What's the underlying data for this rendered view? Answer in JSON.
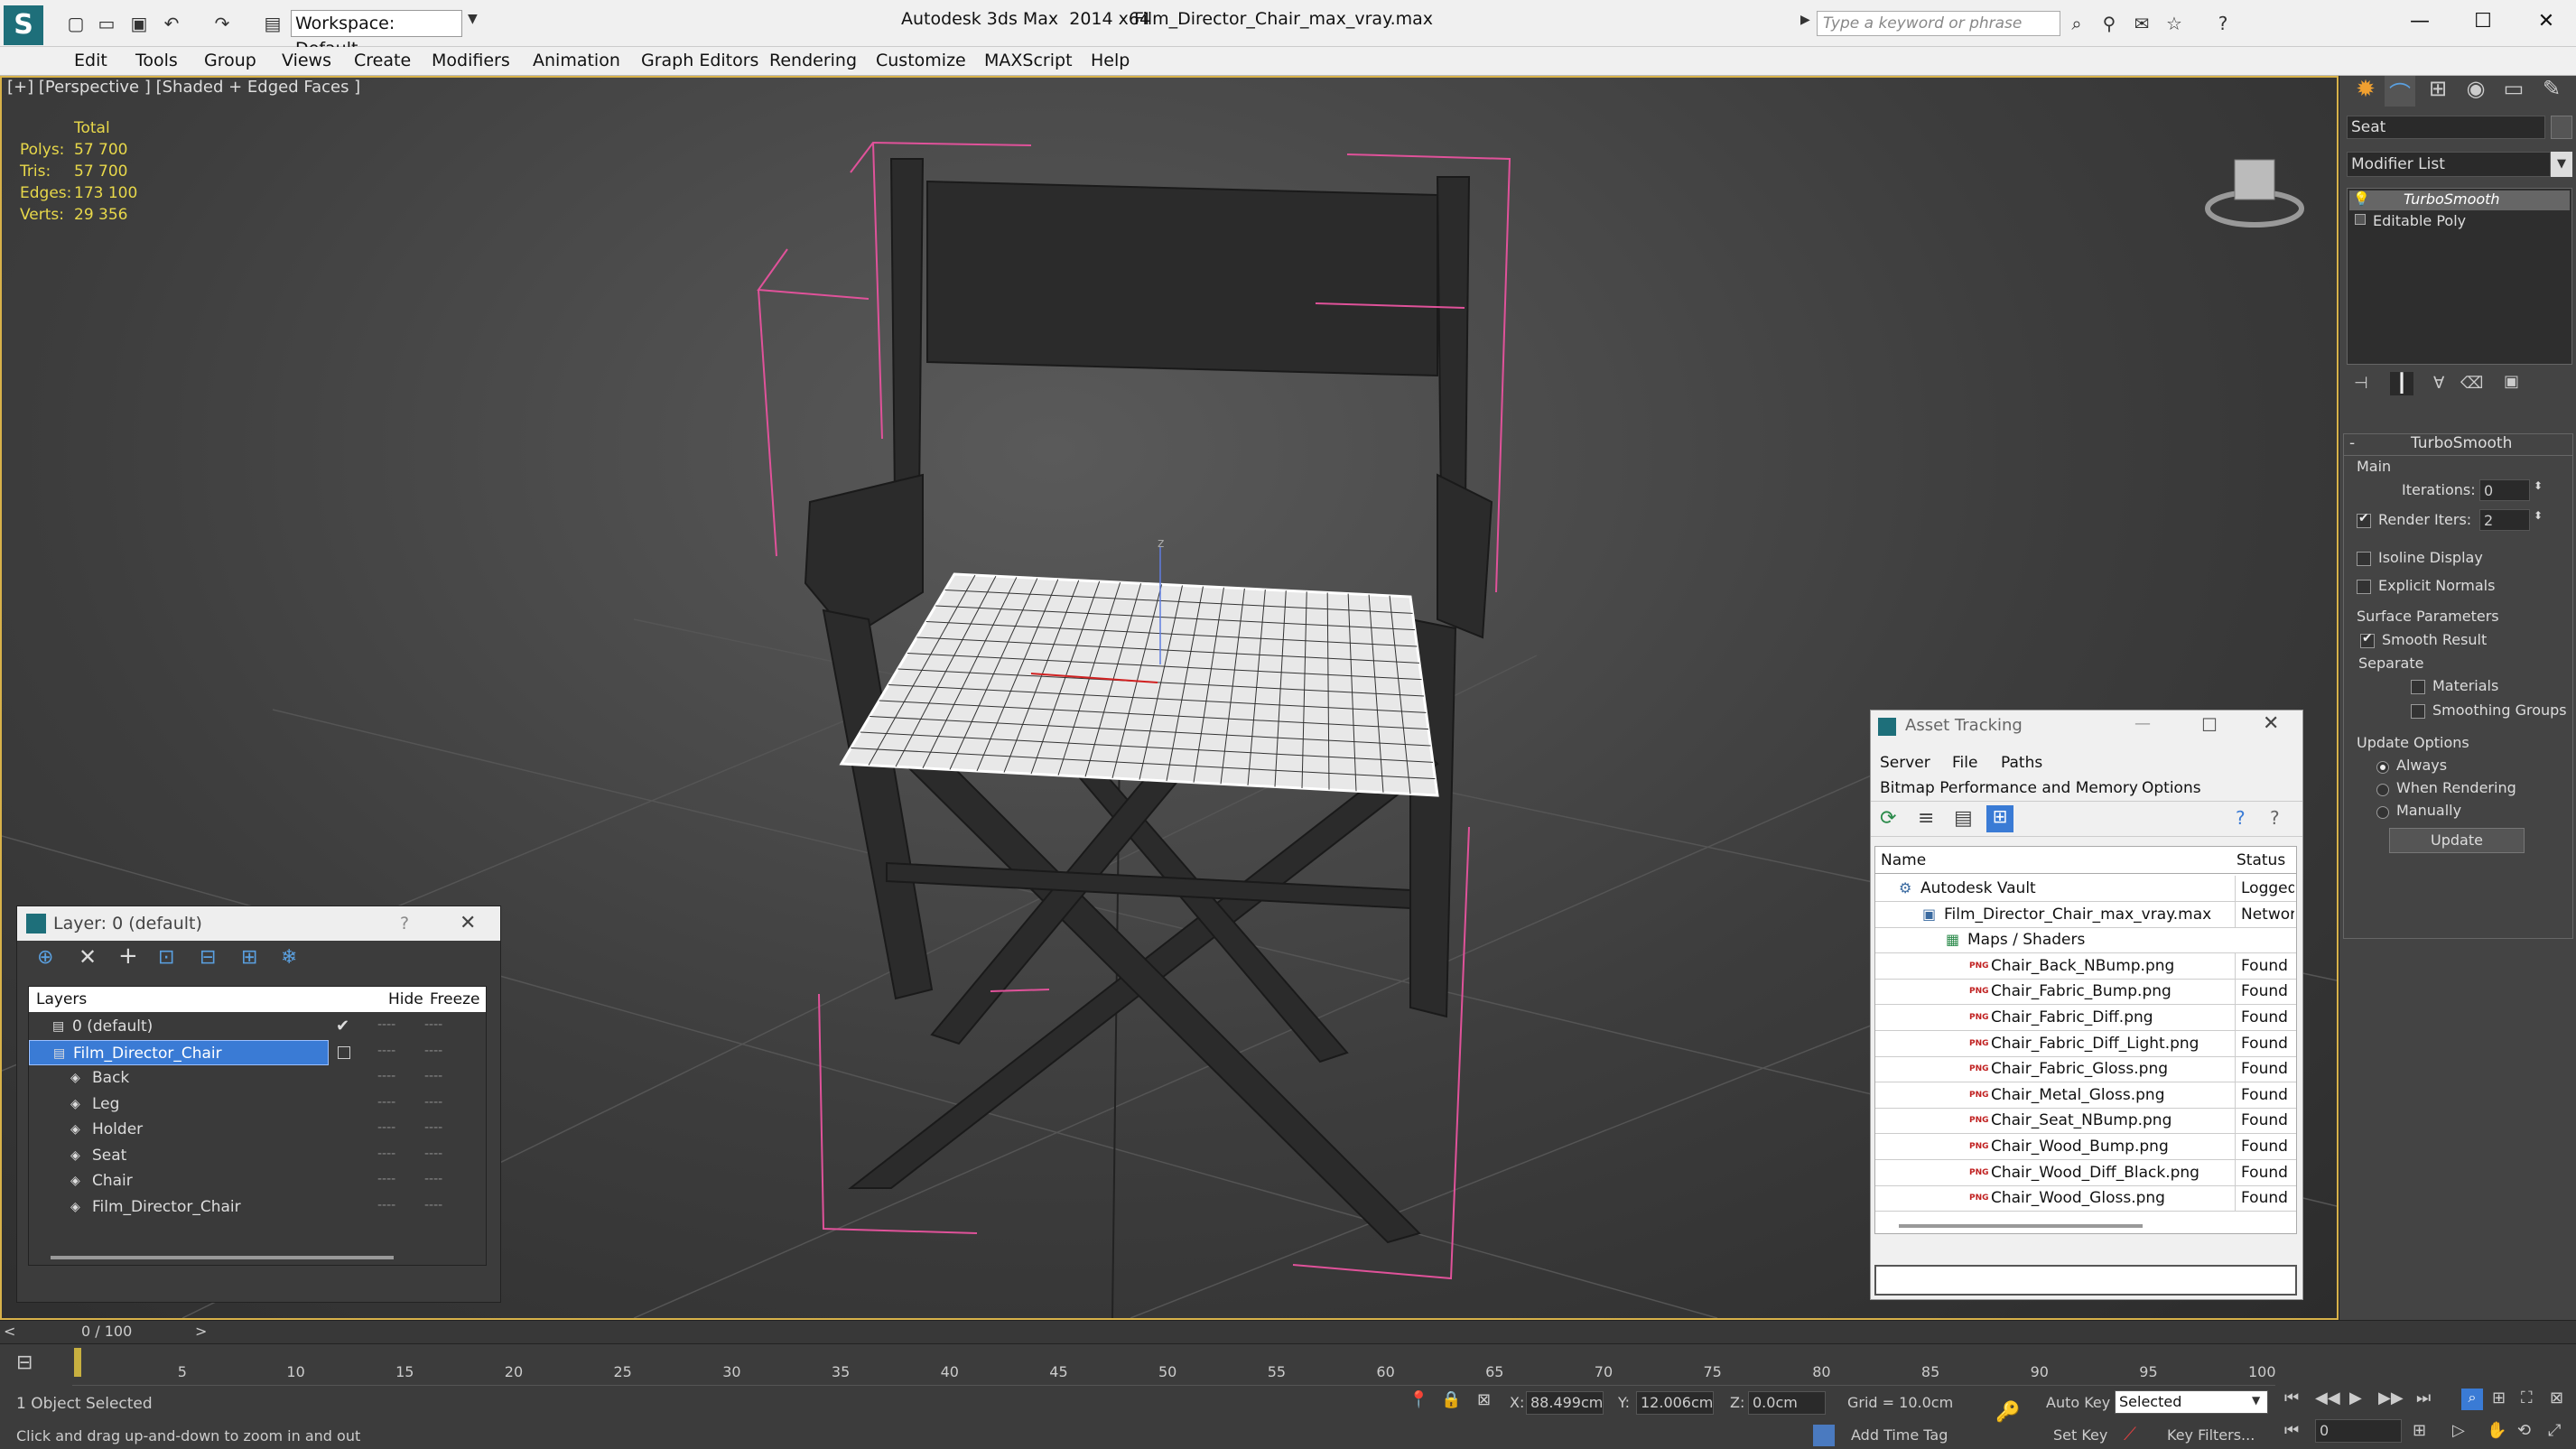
{
  "title_bar": {
    "app_title": "Autodesk 3ds Max  2014 x64",
    "file_name": "Film_Director_Chair_max_vray.max",
    "workspace": "Workspace: Default",
    "search_placeholder": "Type a keyword or phrase"
  },
  "menu": [
    "Edit",
    "Tools",
    "Group",
    "Views",
    "Create",
    "Modifiers",
    "Animation",
    "Graph Editors",
    "Rendering",
    "Customize",
    "MAXScript",
    "Help"
  ],
  "viewport": {
    "label": "[+] [Perspective ] [Shaded + Edged Faces ]",
    "stats_header": "Total",
    "stats": [
      {
        "label": "Polys:",
        "value": "57 700"
      },
      {
        "label": "Tris:",
        "value": "57 700"
      },
      {
        "label": "Edges:",
        "value": "173 100"
      },
      {
        "label": "Verts:",
        "value": "29 356"
      }
    ],
    "axis_label": "z"
  },
  "command_panel": {
    "object_name": "Seat",
    "modifier_list": "Modifier List",
    "stack": [
      "TurboSmooth",
      "Editable Poly"
    ],
    "rollout_title": "TurboSmooth",
    "main_label": "Main",
    "iterations_label": "Iterations:",
    "iterations_value": "0",
    "render_iters_label": "Render Iters:",
    "render_iters_value": "2",
    "isoline_display": "Isoline Display",
    "explicit_normals": "Explicit Normals",
    "surface_parameters": "Surface Parameters",
    "smooth_result": "Smooth Result",
    "separate": "Separate",
    "materials": "Materials",
    "smoothing_groups": "Smoothing Groups",
    "update_options": "Update Options",
    "always": "Always",
    "when_rendering": "When Rendering",
    "manually": "Manually",
    "update_button": "Update"
  },
  "layer_dialog": {
    "title": "Layer: 0 (default)",
    "help": "?",
    "columns": {
      "layers": "Layers",
      "hide": "Hide",
      "freeze": "Freeze"
    },
    "rows": [
      {
        "name": "0 (default)",
        "level": 0,
        "selected": false,
        "current": true
      },
      {
        "name": "Film_Director_Chair",
        "level": 0,
        "selected": true,
        "current": false
      },
      {
        "name": "Back",
        "level": 1,
        "selected": false,
        "current": false
      },
      {
        "name": "Leg",
        "level": 1,
        "selected": false,
        "current": false
      },
      {
        "name": "Holder",
        "level": 1,
        "selected": false,
        "current": false
      },
      {
        "name": "Seat",
        "level": 1,
        "selected": false,
        "current": false
      },
      {
        "name": "Chair",
        "level": 1,
        "selected": false,
        "current": false
      },
      {
        "name": "Film_Director_Chair",
        "level": 1,
        "selected": false,
        "current": false
      }
    ],
    "dash": "----"
  },
  "asset_tracking": {
    "title": "Asset Tracking",
    "menu": [
      "Server",
      "File",
      "Paths"
    ],
    "menu2": [
      "Bitmap Performance and Memory",
      "Options"
    ],
    "columns": {
      "name": "Name",
      "status": "Status"
    },
    "rows": [
      {
        "name": "Autodesk Vault",
        "status": "Logged O",
        "level": 1
      },
      {
        "name": "Film_Director_Chair_max_vray.max",
        "status": "Network",
        "level": 2
      },
      {
        "name": "Maps / Shaders",
        "status": "",
        "level": 3
      },
      {
        "name": "Chair_Back_NBump.png",
        "status": "Found",
        "level": 4
      },
      {
        "name": "Chair_Fabric_Bump.png",
        "status": "Found",
        "level": 4
      },
      {
        "name": "Chair_Fabric_Diff.png",
        "status": "Found",
        "level": 4
      },
      {
        "name": "Chair_Fabric_Diff_Light.png",
        "status": "Found",
        "level": 4
      },
      {
        "name": "Chair_Fabric_Gloss.png",
        "status": "Found",
        "level": 4
      },
      {
        "name": "Chair_Metal_Gloss.png",
        "status": "Found",
        "level": 4
      },
      {
        "name": "Chair_Seat_NBump.png",
        "status": "Found",
        "level": 4
      },
      {
        "name": "Chair_Wood_Bump.png",
        "status": "Found",
        "level": 4
      },
      {
        "name": "Chair_Wood_Diff_Black.png",
        "status": "Found",
        "level": 4
      },
      {
        "name": "Chair_Wood_Gloss.png",
        "status": "Found",
        "level": 4
      }
    ],
    "png_tag": "PNG"
  },
  "timeline": {
    "frame": "0 / 100",
    "ticks": [
      "5",
      "10",
      "15",
      "20",
      "25",
      "30",
      "35",
      "40",
      "45",
      "50",
      "55",
      "60",
      "65",
      "70",
      "75",
      "80",
      "85",
      "90",
      "95",
      "100"
    ]
  },
  "status_bar": {
    "selected": "1 Object Selected",
    "prompt": "Click and drag up-and-down to zoom in and out",
    "x_label": "X:",
    "x_value": "88.499cm",
    "y_label": "Y:",
    "y_value": "12.006cm",
    "z_label": "Z:",
    "z_value": "0.0cm",
    "grid": "Grid = 10.0cm",
    "add_time_tag": "Add Time Tag",
    "auto_key": "Auto Key",
    "set_key": "Set Key",
    "selected_dropdown": "Selected",
    "key_filters": "Key Filters...",
    "frame_field": "0"
  },
  "colors": {
    "accent_blue": "#3a7bd5",
    "stat_yellow": "#e8d84a",
    "selection_pink": "#e0529a",
    "viewport_border": "#d8b24a"
  }
}
